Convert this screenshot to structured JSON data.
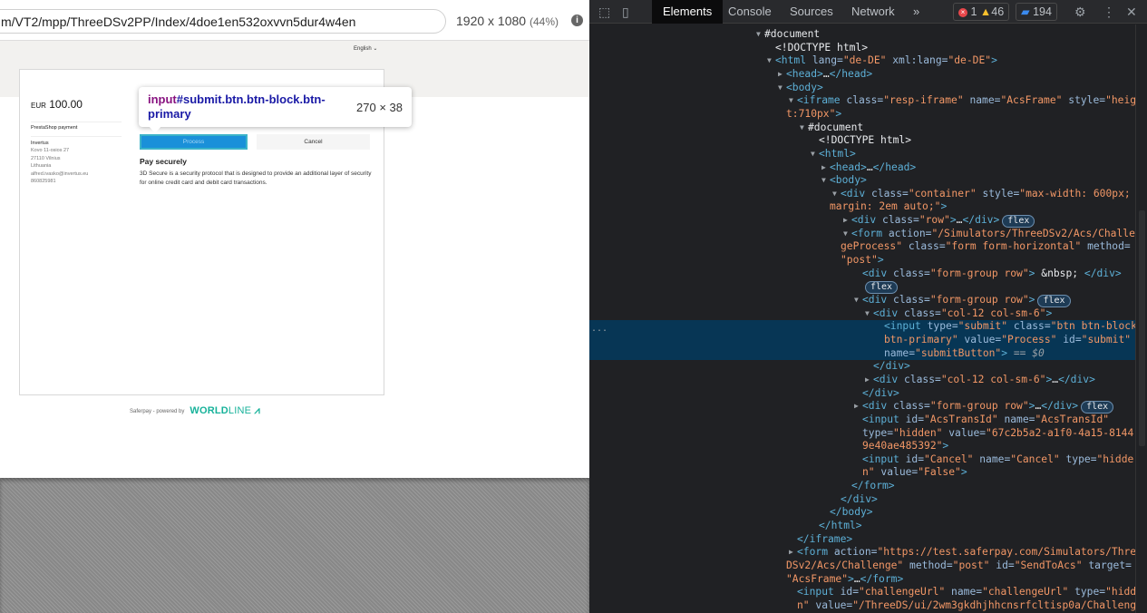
{
  "browser": {
    "url": "m/VT2/mpp/ThreeDSv2PP/Index/4doe1en532oxvvn5dur4w4en",
    "dimensions": "1920 x 1080",
    "zoom": "(44%)"
  },
  "page": {
    "language": "English ⌄",
    "currency": "EUR",
    "amount": "100.00",
    "merchant": "PrestaShop payment",
    "address": {
      "company": "Invertus",
      "street": "Kovo 11-osios 27",
      "city": "27110 Vilnius",
      "country": "Lithuania",
      "email": "alfred.ivasko@invertus.eu",
      "phone": "860825981"
    },
    "process_label": "Process",
    "cancel_label": "Cancel",
    "heading": "Pay securely",
    "description": "3D Secure is a security protocol that is designed to provide an additional layer of security for online credit card and debit card transactions.",
    "footer": "Saferpay - powered by",
    "brand": "WORLDLINE",
    "brand_bold": "WORLD",
    "brand_light": "LINE",
    "accent": "#1a90d9",
    "brand_color": "#17b29a"
  },
  "tooltip": {
    "tag": "input",
    "selector": "#submit.btn.btn-block.btn-primary",
    "size": "270 × 38"
  },
  "devtools": {
    "tabs": [
      "Elements",
      "Console",
      "Sources",
      "Network"
    ],
    "active_tab": "Elements",
    "more": "»",
    "errors": "1",
    "warnings": "46",
    "messages": "194",
    "selected_marker": "...",
    "lines": [
      {
        "d": 0,
        "arrow": "▼",
        "t": [
          [
            "x",
            "#document"
          ]
        ]
      },
      {
        "d": 1,
        "t": [
          [
            "x",
            "<!DOCTYPE html>"
          ]
        ]
      },
      {
        "d": 1,
        "arrow": "▼",
        "t": [
          [
            "p",
            "<html"
          ],
          [
            "a",
            " lang="
          ],
          [
            "v",
            "\"de-DE\""
          ],
          [
            "a",
            " xml:lang="
          ],
          [
            "v",
            "\"de-DE\""
          ],
          [
            "p",
            ">"
          ]
        ]
      },
      {
        "d": 2,
        "arrow": "▶",
        "t": [
          [
            "p",
            "<head>"
          ],
          [
            "x",
            "…"
          ],
          [
            "p",
            "</head>"
          ]
        ]
      },
      {
        "d": 2,
        "arrow": "▼",
        "t": [
          [
            "p",
            "<body>"
          ]
        ]
      },
      {
        "d": 3,
        "arrow": "▼",
        "t": [
          [
            "p",
            "<iframe"
          ],
          [
            "a",
            " class="
          ],
          [
            "v",
            "\"resp-iframe\""
          ],
          [
            "a",
            " name="
          ],
          [
            "v",
            "\"AcsFrame\""
          ],
          [
            "a",
            " style="
          ],
          [
            "v",
            "\"heigh"
          ]
        ]
      },
      {
        "d": 3,
        "cont": true,
        "t": [
          [
            "v",
            "t:710px\""
          ],
          [
            "p",
            ">"
          ]
        ]
      },
      {
        "d": 4,
        "arrow": "▼",
        "t": [
          [
            "x",
            "#document"
          ]
        ]
      },
      {
        "d": 5,
        "t": [
          [
            "x",
            "<!DOCTYPE html>"
          ]
        ]
      },
      {
        "d": 5,
        "arrow": "▼",
        "t": [
          [
            "p",
            "<html>"
          ]
        ]
      },
      {
        "d": 6,
        "arrow": "▶",
        "t": [
          [
            "p",
            "<head>"
          ],
          [
            "x",
            "…"
          ],
          [
            "p",
            "</head>"
          ]
        ]
      },
      {
        "d": 6,
        "arrow": "▼",
        "t": [
          [
            "p",
            "<body>"
          ]
        ]
      },
      {
        "d": 7,
        "arrow": "▼",
        "t": [
          [
            "p",
            "<div"
          ],
          [
            "a",
            " class="
          ],
          [
            "v",
            "\"container\""
          ],
          [
            "a",
            " style="
          ],
          [
            "v",
            "\"max-width: 600px;"
          ]
        ]
      },
      {
        "d": 7,
        "cont": true,
        "t": [
          [
            "v",
            "margin: 2em auto;\""
          ],
          [
            "p",
            ">"
          ]
        ]
      },
      {
        "d": 8,
        "arrow": "▶",
        "t": [
          [
            "p",
            "<div"
          ],
          [
            "a",
            " class="
          ],
          [
            "v",
            "\"row\""
          ],
          [
            "p",
            ">"
          ],
          [
            "x",
            "…"
          ],
          [
            "p",
            "</div>"
          ],
          [
            "b",
            "flex"
          ]
        ]
      },
      {
        "d": 8,
        "arrow": "▼",
        "t": [
          [
            "p",
            "<form"
          ],
          [
            "a",
            " action="
          ],
          [
            "v",
            "\"/Simulators/ThreeDSv2/Acs/Challen"
          ]
        ]
      },
      {
        "d": 8,
        "cont": true,
        "t": [
          [
            "v",
            "geProcess\""
          ],
          [
            "a",
            " class="
          ],
          [
            "v",
            "\"form form-horizontal\""
          ],
          [
            "a",
            " method="
          ]
        ]
      },
      {
        "d": 8,
        "cont": true,
        "t": [
          [
            "v",
            "\"post\""
          ],
          [
            "p",
            ">"
          ]
        ]
      },
      {
        "d": 9,
        "t": [
          [
            "p",
            "<div"
          ],
          [
            "a",
            " class="
          ],
          [
            "v",
            "\"form-group row\""
          ],
          [
            "p",
            ">"
          ],
          [
            "x",
            " &nbsp; "
          ],
          [
            "p",
            "</div>"
          ]
        ]
      },
      {
        "d": 9,
        "t": [
          [
            "b",
            "flex"
          ]
        ]
      },
      {
        "d": 9,
        "arrow": "▼",
        "t": [
          [
            "p",
            "<div"
          ],
          [
            "a",
            " class="
          ],
          [
            "v",
            "\"form-group row\""
          ],
          [
            "p",
            ">"
          ],
          [
            "b",
            "flex"
          ]
        ]
      },
      {
        "d": 10,
        "arrow": "▼",
        "t": [
          [
            "p",
            "<div"
          ],
          [
            "a",
            " class="
          ],
          [
            "v",
            "\"col-12 col-sm-6\""
          ],
          [
            "p",
            ">"
          ]
        ]
      },
      {
        "d": 11,
        "hl": true,
        "t": [
          [
            "p",
            "<input"
          ],
          [
            "a",
            " type="
          ],
          [
            "v",
            "\"submit\""
          ],
          [
            "a",
            " class="
          ],
          [
            "v",
            "\"btn btn-block"
          ]
        ]
      },
      {
        "d": 11,
        "hl": true,
        "t": [
          [
            "v",
            "btn-primary\""
          ],
          [
            "a",
            " value="
          ],
          [
            "v",
            "\"Process\""
          ],
          [
            "a",
            " id="
          ],
          [
            "v",
            "\"submit\""
          ]
        ]
      },
      {
        "d": 11,
        "hl": true,
        "t": [
          [
            "a",
            "name="
          ],
          [
            "v",
            "\"submitButton\""
          ],
          [
            "p",
            ">"
          ],
          [
            "d",
            " == $0"
          ]
        ]
      },
      {
        "d": 10,
        "t": [
          [
            "p",
            "</div>"
          ]
        ]
      },
      {
        "d": 10,
        "arrow": "▶",
        "t": [
          [
            "p",
            "<div"
          ],
          [
            "a",
            " class="
          ],
          [
            "v",
            "\"col-12 col-sm-6\""
          ],
          [
            "p",
            ">"
          ],
          [
            "x",
            "…"
          ],
          [
            "p",
            "</div>"
          ]
        ]
      },
      {
        "d": 9,
        "t": [
          [
            "p",
            "</div>"
          ]
        ]
      },
      {
        "d": 9,
        "arrow": "▶",
        "t": [
          [
            "p",
            "<div"
          ],
          [
            "a",
            " class="
          ],
          [
            "v",
            "\"form-group row\""
          ],
          [
            "p",
            ">"
          ],
          [
            "x",
            "…"
          ],
          [
            "p",
            "</div>"
          ],
          [
            "b",
            "flex"
          ]
        ]
      },
      {
        "d": 9,
        "t": [
          [
            "p",
            "<input"
          ],
          [
            "a",
            " id="
          ],
          [
            "v",
            "\"AcsTransId\""
          ],
          [
            "a",
            " name="
          ],
          [
            "v",
            "\"AcsTransId\""
          ]
        ]
      },
      {
        "d": 9,
        "t": [
          [
            "a",
            "type="
          ],
          [
            "v",
            "\"hidden\""
          ],
          [
            "a",
            " value="
          ],
          [
            "v",
            "\"67c2b5a2-a1f0-4a15-8144-"
          ]
        ]
      },
      {
        "d": 9,
        "t": [
          [
            "v",
            "9e40ae485392\""
          ],
          [
            "p",
            ">"
          ]
        ]
      },
      {
        "d": 9,
        "t": [
          [
            "p",
            "<input"
          ],
          [
            "a",
            " id="
          ],
          [
            "v",
            "\"Cancel\""
          ],
          [
            "a",
            " name="
          ],
          [
            "v",
            "\"Cancel\""
          ],
          [
            "a",
            " type="
          ],
          [
            "v",
            "\"hidde"
          ]
        ]
      },
      {
        "d": 9,
        "t": [
          [
            "v",
            "n\""
          ],
          [
            "a",
            " value="
          ],
          [
            "v",
            "\"False\""
          ],
          [
            "p",
            ">"
          ]
        ]
      },
      {
        "d": 8,
        "t": [
          [
            "p",
            "</form>"
          ]
        ]
      },
      {
        "d": 7,
        "t": [
          [
            "p",
            "</div>"
          ]
        ]
      },
      {
        "d": 6,
        "t": [
          [
            "p",
            "</body>"
          ]
        ]
      },
      {
        "d": 5,
        "t": [
          [
            "p",
            "</html>"
          ]
        ]
      },
      {
        "d": 3,
        "t": [
          [
            "p",
            "</iframe>"
          ]
        ]
      },
      {
        "d": 3,
        "arrow": "▶",
        "t": [
          [
            "p",
            "<form"
          ],
          [
            "a",
            " action="
          ],
          [
            "v",
            "\"https://test.saferpay.com/Simulators/Three"
          ]
        ]
      },
      {
        "d": 3,
        "cont": true,
        "t": [
          [
            "v",
            "DSv2/Acs/Challenge\""
          ],
          [
            "a",
            " method="
          ],
          [
            "v",
            "\"post\""
          ],
          [
            "a",
            " id="
          ],
          [
            "v",
            "\"SendToAcs\""
          ],
          [
            "a",
            " target="
          ]
        ]
      },
      {
        "d": 3,
        "cont": true,
        "t": [
          [
            "v",
            "\"AcsFrame\""
          ],
          [
            "p",
            ">"
          ],
          [
            "x",
            "…"
          ],
          [
            "p",
            "</form>"
          ]
        ]
      },
      {
        "d": 3,
        "t": [
          [
            "p",
            "<input"
          ],
          [
            "a",
            " id="
          ],
          [
            "v",
            "\"challengeUrl\""
          ],
          [
            "a",
            " name="
          ],
          [
            "v",
            "\"challengeUrl\""
          ],
          [
            "a",
            " type="
          ],
          [
            "v",
            "\"hidde"
          ]
        ]
      },
      {
        "d": 3,
        "t": [
          [
            "v",
            "n\""
          ],
          [
            "a",
            " value="
          ],
          [
            "v",
            "\"/ThreeDS/ui/2wm3gkdhjhhcnsrfcltisp0a/Challeng"
          ]
        ]
      }
    ]
  }
}
